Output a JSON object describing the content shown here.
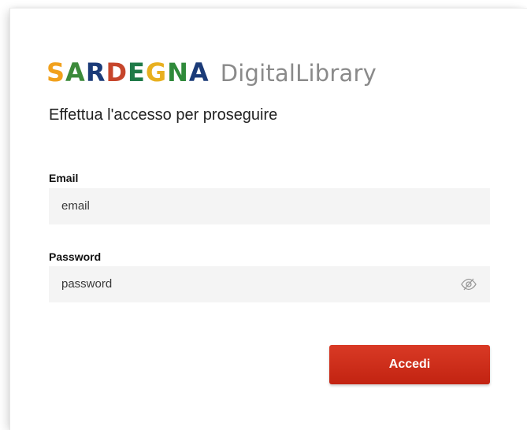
{
  "logo": {
    "word": "SARDEGNA",
    "letter_colors": [
      "#f1a11d",
      "#3c8a3a",
      "#1b3b78",
      "#c6452b",
      "#1f7a48",
      "#e8b020",
      "#2f8a3a",
      "#1b3b78"
    ],
    "sub": "DigitalLibrary"
  },
  "subtitle": "Effettua l'accesso per proseguire",
  "email": {
    "label": "Email",
    "placeholder": "email"
  },
  "password": {
    "label": "Password",
    "placeholder": "password",
    "toggle_icon": "eye-off-icon"
  },
  "submit": {
    "label": "Accedi",
    "color": "#c8281a"
  }
}
